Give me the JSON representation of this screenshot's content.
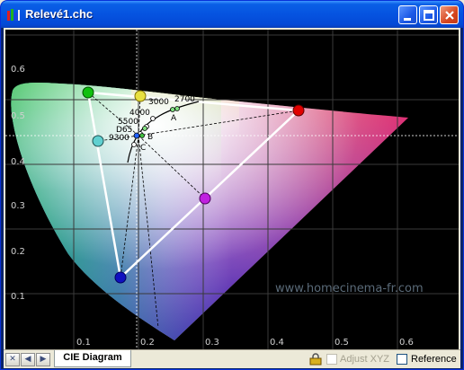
{
  "window": {
    "title": "Relevé1.chc"
  },
  "diagram": {
    "axis_y_ticks": [
      "0.6",
      "0.5",
      "0.4",
      "0.3",
      "0.2",
      "0.1"
    ],
    "axis_x_ticks": [
      "0.1",
      "0.2",
      "0.3",
      "0.4",
      "0.5",
      "0.6"
    ],
    "cct_labels": [
      "2700",
      "3000",
      "4000",
      "5500",
      "D65",
      "9300"
    ],
    "illuminant_labels": [
      "A",
      "B",
      "C"
    ],
    "watermark": "www.homecinema-fr.com",
    "colors": {
      "red": "#e00000",
      "green": "#10c010",
      "blue": "#1010c0",
      "cyan": "#60d0d0",
      "magenta": "#c020e0",
      "yellow": "#e8e040"
    }
  },
  "bottom": {
    "tab_label": "CIE Diagram",
    "adjust_xyz_label": "Adjust XYZ",
    "reference_label": "Reference"
  }
}
